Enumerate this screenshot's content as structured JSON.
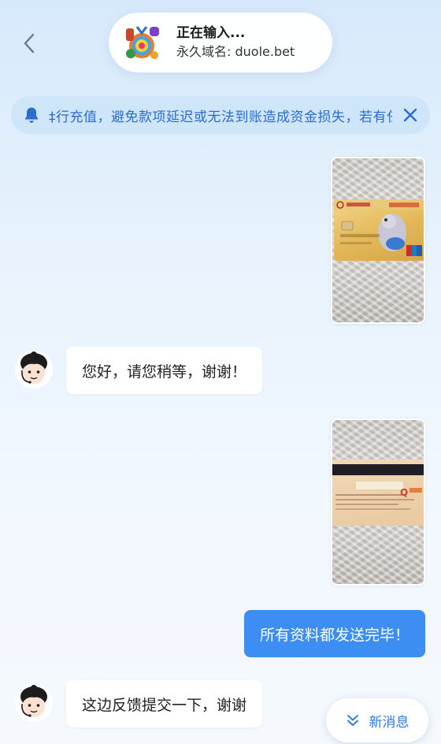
{
  "header": {
    "status": "正在输入...",
    "domain": "永久域名: duole.bet"
  },
  "notice": {
    "text": "‡行充值，避免款项延迟或无法到账造成资金损失，若有任何疑问请联系客服。"
  },
  "messages": [
    {
      "type": "image",
      "side": "right",
      "description": "card-front-photo"
    },
    {
      "type": "text",
      "side": "left",
      "text": "您好，请您稍等，谢谢！"
    },
    {
      "type": "image",
      "side": "right",
      "description": "card-back-photo"
    },
    {
      "type": "text",
      "side": "right",
      "text": "所有资料都发送完毕！"
    },
    {
      "type": "text",
      "side": "left",
      "text": "这边反馈提交一下，谢谢"
    }
  ],
  "new_message_button": {
    "label": "新消息"
  },
  "colors": {
    "accent": "#3d8ef2",
    "notice_text": "#2a6ccf",
    "bubble_left": "#ffffff"
  },
  "icons": {
    "back": "chevron-left-icon",
    "bell": "bell-icon",
    "close": "close-icon",
    "new_message": "double-chevron-down-icon"
  }
}
